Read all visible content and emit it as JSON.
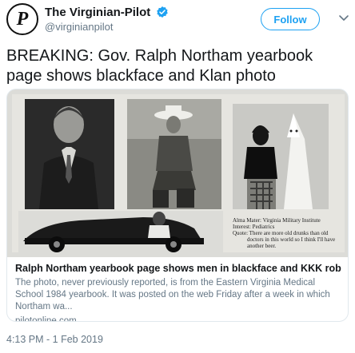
{
  "author": {
    "name": "The Virginian-Pilot",
    "handle": "@virginianpilot",
    "avatar_letter": "P",
    "verified_icon": "verified-badge-icon"
  },
  "follow_label": "Follow",
  "menu_icon": "chevron-down-icon",
  "tweet": {
    "text": "BREAKING: Gov. Ralph Northam yearbook page shows blackface and Klan photo"
  },
  "card": {
    "yearbook_caption": [
      "Alma Mater: Virginia Military Institute",
      "Interest: Pediatrics",
      "Quote: There are more old drunks than old",
      "doctors in this world so I think I'll have",
      "another beer."
    ],
    "title": "Ralph Northam yearbook page shows men in blackface and KKK robe",
    "description": "The photo, never previously reported, is from the Eastern Virginia Medical School 1984 yearbook. It was posted on the web Friday after a week in which Northam wa...",
    "domain": "pilotonline.com"
  },
  "timestamp": "4:13 PM - 1 Feb 2019",
  "colors": {
    "accent": "#1da1f2",
    "text": "#14171a",
    "secondary": "#657786",
    "border": "#e1e8ed"
  }
}
